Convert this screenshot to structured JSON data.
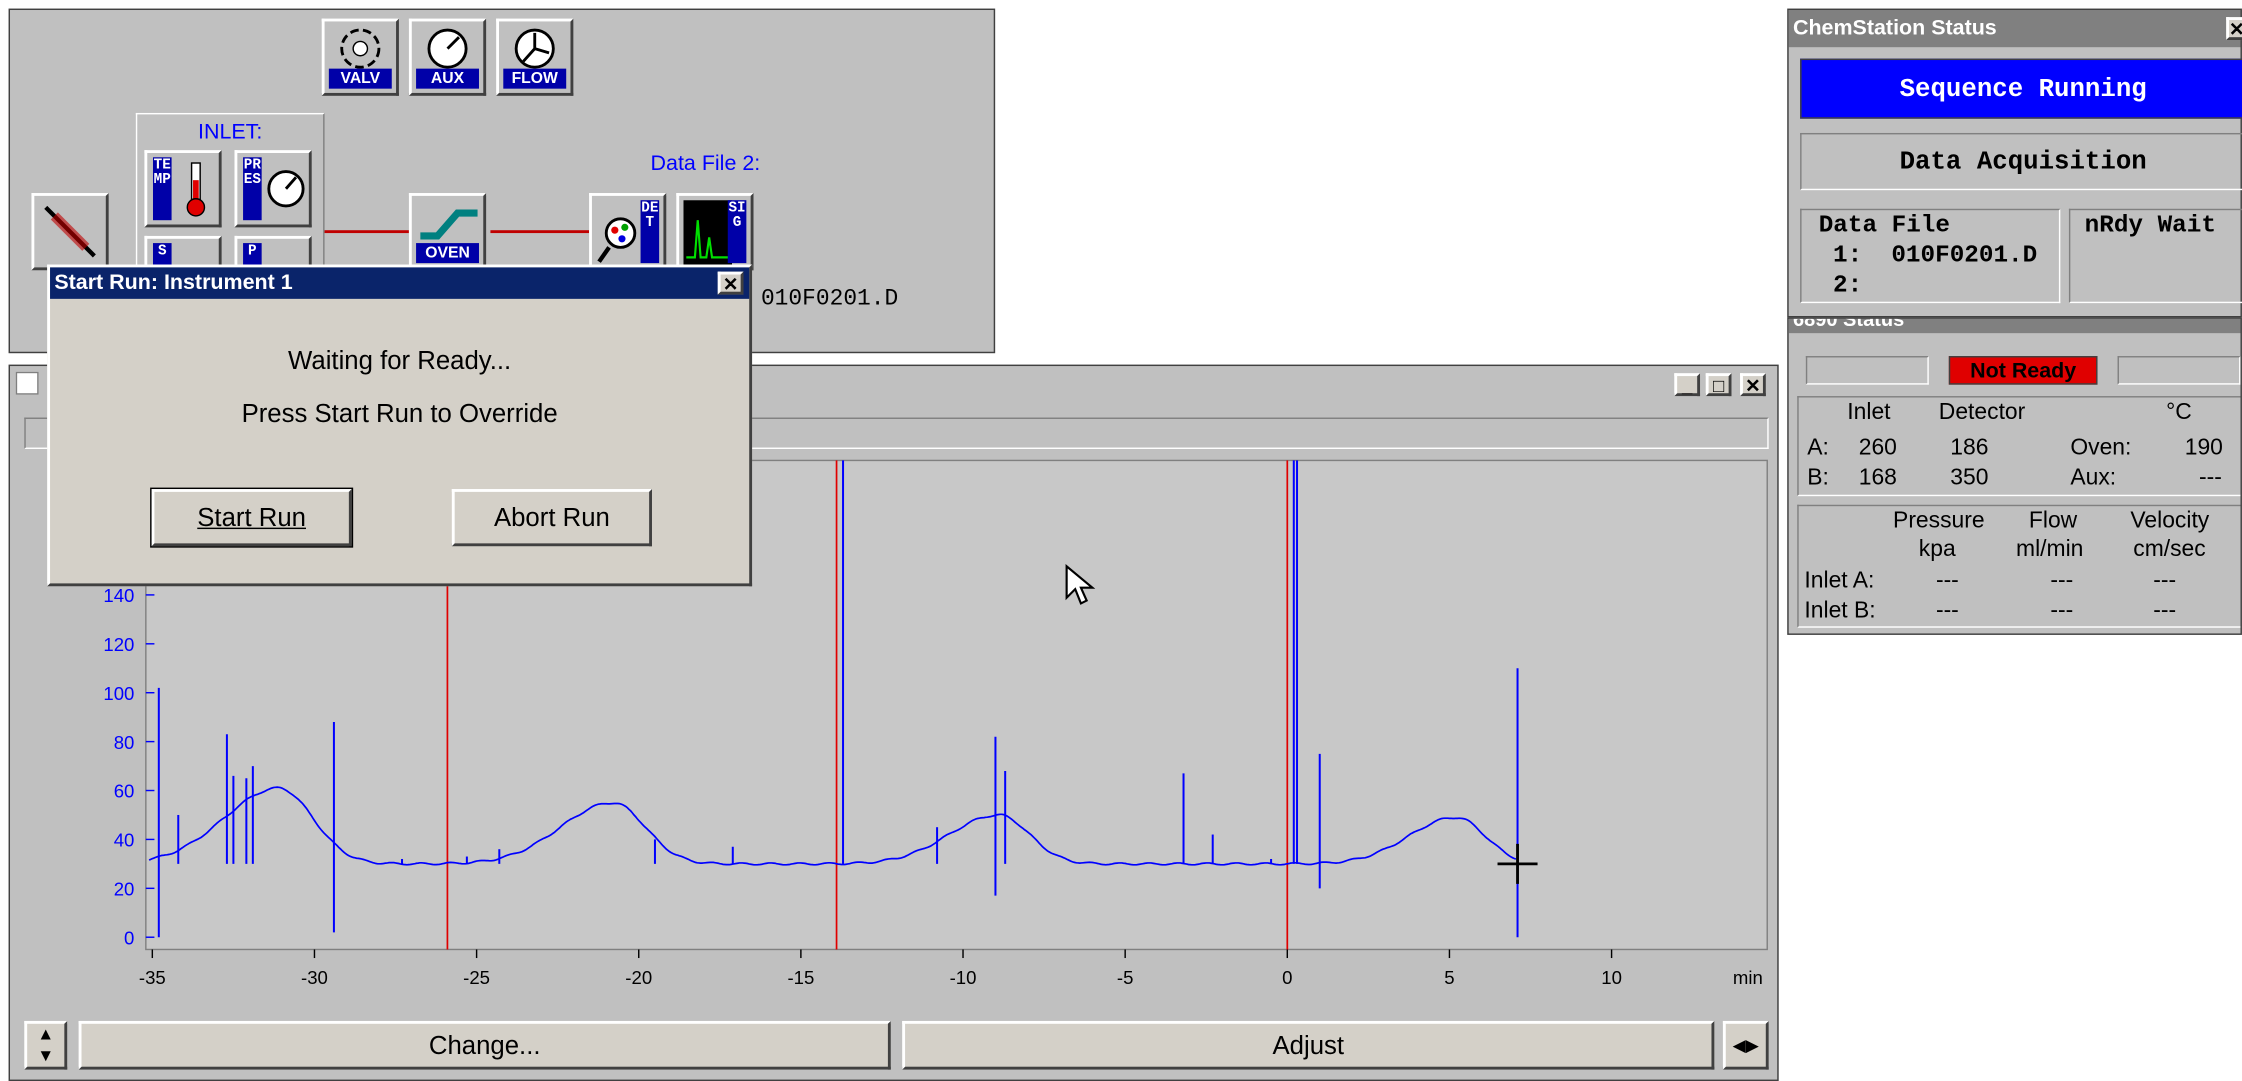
{
  "instrument_panel": {
    "inlet_label": "INLET:",
    "datafile2_label": "Data File 2:",
    "datafile1_value": ": 010F0201.D",
    "buttons": {
      "valv": "VALV",
      "aux": "AUX",
      "flow": "FLOW",
      "temp": "TEMP",
      "pres": "PRES",
      "oven": "OVEN",
      "det": "DET",
      "sig": "SIG",
      "s_partial": "S",
      "p_partial": "P"
    }
  },
  "dialog": {
    "title": "Start Run: Instrument 1",
    "line1": "Waiting for Ready...",
    "line2": "Press Start Run to Override",
    "start_button": "Start Run",
    "abort_button": "Abort Run"
  },
  "status_window": {
    "title": "ChemStation Status",
    "sequence_status": "Sequence Running",
    "acquisition": "Data Acquisition",
    "data_file_label": "Data File",
    "file1": "1:  010F0201.D",
    "file2": "2:",
    "nrdy": "nRdy Wait"
  },
  "gc_status": {
    "title": "6890 Status",
    "not_ready": "Not Ready",
    "headers": {
      "inlet": "Inlet",
      "detector": "Detector",
      "unit": "°C"
    },
    "row_a": {
      "label": "A:",
      "inlet": "260",
      "detector": "186",
      "oven_label": "Oven:",
      "oven": "190"
    },
    "row_b": {
      "label": "B:",
      "inlet": "168",
      "detector": "350",
      "aux_label": "Aux:",
      "aux": "---"
    },
    "flow_headers": {
      "pressure": "Pressure",
      "pressure_unit": "kpa",
      "flow": "Flow",
      "flow_unit": "ml/min",
      "velocity": "Velocity",
      "velocity_unit": "cm/sec"
    },
    "inlet_a": {
      "label": "Inlet A:",
      "pressure": "---",
      "flow": "---",
      "velocity": "---"
    },
    "inlet_b": {
      "label": "Inlet B:",
      "pressure": "---",
      "flow": "---",
      "velocity": "---"
    }
  },
  "plot_window": {
    "change_button": "Change...",
    "adjust_button": "Adjust",
    "x_unit": "min"
  },
  "chart_data": {
    "type": "line",
    "xlim": [
      -35.2,
      14.8
    ],
    "ylim": [
      -5,
      195
    ],
    "x_ticks": [
      -35,
      -30,
      -25,
      -20,
      -15,
      -10,
      -5,
      0,
      5,
      10
    ],
    "y_ticks": [
      0,
      20,
      40,
      60,
      80,
      100,
      120,
      140
    ],
    "x_unit_label": "min",
    "grid": false,
    "baseline": 30,
    "peaks": [
      {
        "center": -31.1,
        "height": 31,
        "width": 1.05
      },
      {
        "center": -20.8,
        "height": 25,
        "width": 1.0
      },
      {
        "center": -8.9,
        "height": 20,
        "width": 0.95
      },
      {
        "center": 5.2,
        "height": 19,
        "width": 0.9
      }
    ],
    "red_markers": [
      -25.9,
      -13.9,
      0.0
    ],
    "spikes": [
      {
        "x": -34.8,
        "top": 102,
        "bottom": 0
      },
      {
        "x": -34.2,
        "top": 50,
        "bottom": 30
      },
      {
        "x": -32.7,
        "top": 83,
        "bottom": 30
      },
      {
        "x": -32.5,
        "top": 66,
        "bottom": 30
      },
      {
        "x": -32.1,
        "top": 65,
        "bottom": 30
      },
      {
        "x": -31.9,
        "top": 70,
        "bottom": 30
      },
      {
        "x": -29.4,
        "top": 88,
        "bottom": 2
      },
      {
        "x": -27.3,
        "top": 32,
        "bottom": 30
      },
      {
        "x": -25.3,
        "top": 33,
        "bottom": 30
      },
      {
        "x": -24.3,
        "top": 36,
        "bottom": 30
      },
      {
        "x": -19.5,
        "top": 40,
        "bottom": 30
      },
      {
        "x": -17.1,
        "top": 37,
        "bottom": 30
      },
      {
        "x": -13.7,
        "top": 195,
        "bottom": 30
      },
      {
        "x": -10.8,
        "top": 45,
        "bottom": 30
      },
      {
        "x": -9.0,
        "top": 82,
        "bottom": 17
      },
      {
        "x": -8.7,
        "top": 68,
        "bottom": 30
      },
      {
        "x": -3.2,
        "top": 67,
        "bottom": 30
      },
      {
        "x": -2.3,
        "top": 42,
        "bottom": 30
      },
      {
        "x": -0.5,
        "top": 32,
        "bottom": 30
      },
      {
        "x": 0.2,
        "top": 195,
        "bottom": 30
      },
      {
        "x": 0.3,
        "top": 195,
        "bottom": 30
      },
      {
        "x": 1.0,
        "top": 75,
        "bottom": 20
      },
      {
        "x": 7.1,
        "top": 110,
        "bottom": 0
      }
    ]
  }
}
